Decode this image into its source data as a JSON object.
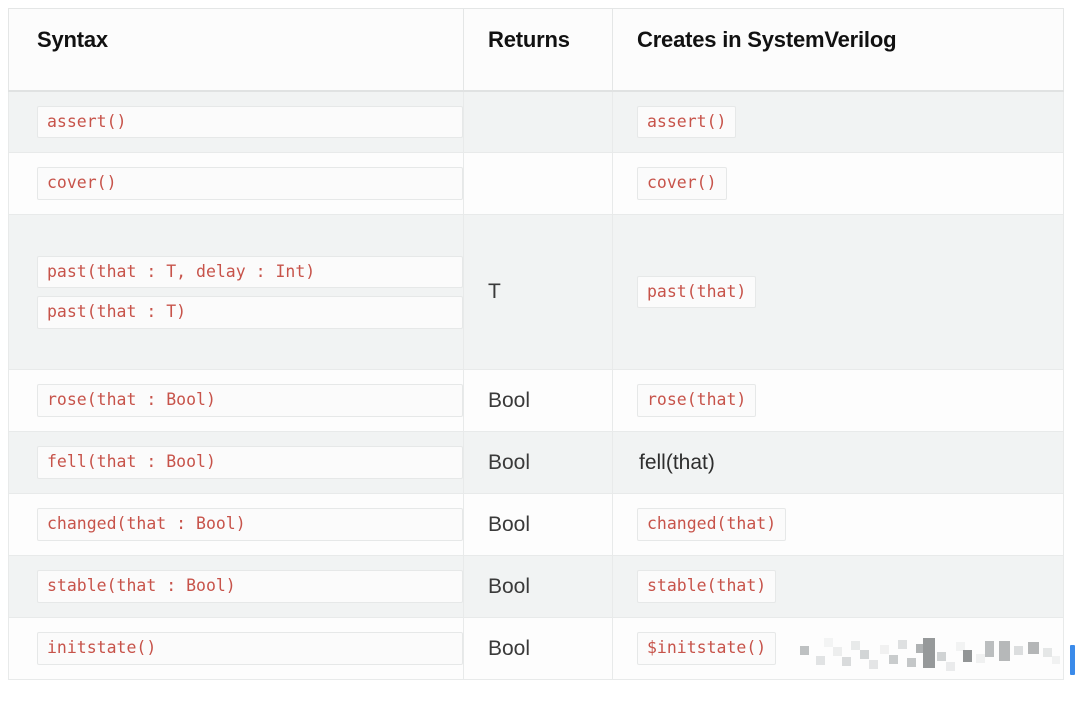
{
  "table": {
    "columns": [
      {
        "key": "syntax",
        "label": "Syntax"
      },
      {
        "key": "returns",
        "label": "Returns"
      },
      {
        "key": "creates",
        "label": "Creates in SystemVerilog"
      }
    ],
    "rows": [
      {
        "syntax": [
          "assert()"
        ],
        "returns": "",
        "creates": "assert()",
        "creates_is_code": true
      },
      {
        "syntax": [
          "cover()"
        ],
        "returns": "",
        "creates": "cover()",
        "creates_is_code": true
      },
      {
        "syntax": [
          "past(that : T, delay : Int)",
          "past(that : T)"
        ],
        "returns": "T",
        "creates": "past(that)",
        "creates_is_code": true
      },
      {
        "syntax": [
          "rose(that : Bool)"
        ],
        "returns": "Bool",
        "creates": "rose(that)",
        "creates_is_code": true
      },
      {
        "syntax": [
          "fell(that : Bool)"
        ],
        "returns": "Bool",
        "creates": "fell(that)",
        "creates_is_code": false
      },
      {
        "syntax": [
          "changed(that : Bool)"
        ],
        "returns": "Bool",
        "creates": "changed(that)",
        "creates_is_code": true
      },
      {
        "syntax": [
          "stable(that : Bool)"
        ],
        "returns": "Bool",
        "creates": "stable(that)",
        "creates_is_code": true
      },
      {
        "syntax": [
          "initstate()"
        ],
        "returns": "Bool",
        "creates": "$initstate()",
        "creates_is_code": true
      }
    ]
  },
  "colors": {
    "code_text": "#c7534a",
    "code_bg": "#fbfbfb",
    "code_border": "#e6e8e8",
    "stripe_bg": "#f1f3f3",
    "row_bg": "#fdfdfd",
    "header_text": "#111111",
    "body_text": "#3a3a3a",
    "grid_line": "#e8eaea",
    "scroll_marker": "#3b8bea"
  }
}
